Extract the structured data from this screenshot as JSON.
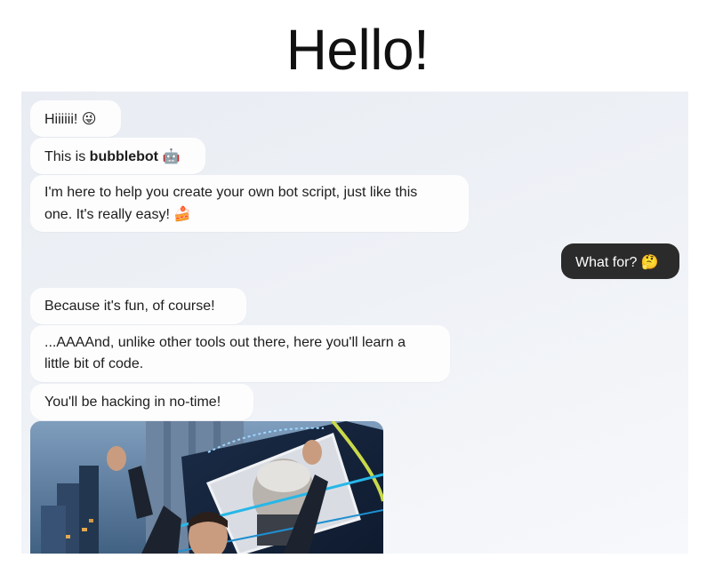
{
  "page": {
    "title": "Hello!"
  },
  "messages": [
    {
      "from": "bot",
      "text": "Hiiiiii!",
      "emoji": "😜"
    },
    {
      "from": "bot",
      "prefix": "This is ",
      "bold": "bubblebot",
      "emoji": "🤖"
    },
    {
      "from": "bot",
      "line1": "I'm here to help you create your own bot script, just like this",
      "line2": "one. It's really easy!",
      "emoji": "🍰"
    },
    {
      "from": "user",
      "text": "What for?",
      "emoji": "🤔"
    },
    {
      "from": "bot",
      "text": "Because it's fun, of course!"
    },
    {
      "from": "bot",
      "line1": "...AAAAnd, unlike other tools out there, here you'll learn a",
      "line2": "little bit of code."
    },
    {
      "from": "bot",
      "text": "You'll be hacking in no-time!"
    }
  ],
  "colors": {
    "chat_bg": "#eceff4",
    "bot_bubble": "#fdfdfe",
    "user_bubble": "#2b2b2b"
  }
}
